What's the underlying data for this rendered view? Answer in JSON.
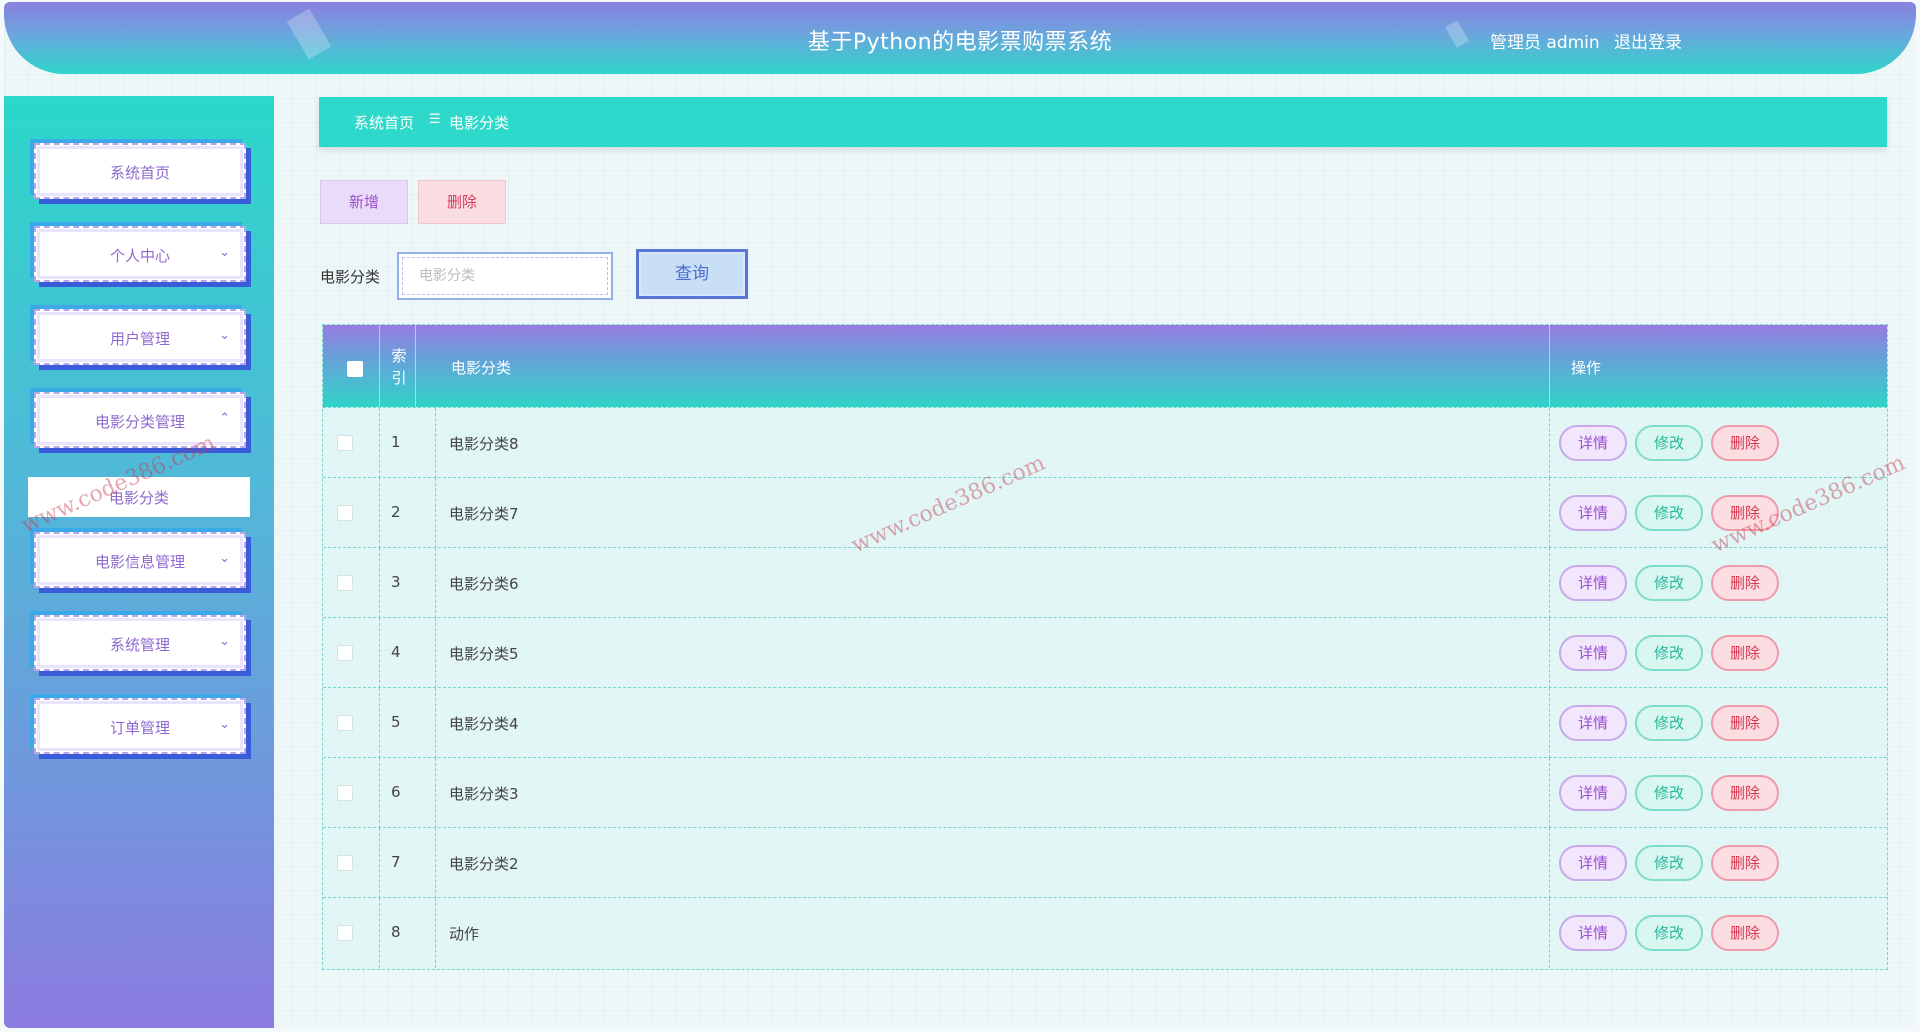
{
  "header": {
    "title": "基于Python的电影票购票系统",
    "user": "管理员 admin",
    "logout": "退出登录"
  },
  "sidebar": {
    "items": [
      {
        "label": "系统首页",
        "chevron": ""
      },
      {
        "label": "个人中心",
        "chevron": "⌄"
      },
      {
        "label": "用户管理",
        "chevron": "⌄"
      },
      {
        "label": "电影分类管理",
        "chevron": "⌃"
      },
      {
        "label": "电影信息管理",
        "chevron": "⌄"
      },
      {
        "label": "系统管理",
        "chevron": "⌄"
      },
      {
        "label": "订单管理",
        "chevron": "⌄"
      }
    ],
    "active_sub": "电影分类"
  },
  "breadcrumb": {
    "home": "系统首页",
    "separator": "☰",
    "current": "电影分类"
  },
  "actions": {
    "add": "新增",
    "delete": "删除"
  },
  "search": {
    "label": "电影分类",
    "placeholder": "电影分类",
    "button": "查询"
  },
  "table": {
    "headers": {
      "index": "索引",
      "category": "电影分类",
      "ops": "操作"
    },
    "rows": [
      {
        "index": "1",
        "category": "电影分类8"
      },
      {
        "index": "2",
        "category": "电影分类7"
      },
      {
        "index": "3",
        "category": "电影分类6"
      },
      {
        "index": "4",
        "category": "电影分类5"
      },
      {
        "index": "5",
        "category": "电影分类4"
      },
      {
        "index": "6",
        "category": "电影分类3"
      },
      {
        "index": "7",
        "category": "电影分类2"
      },
      {
        "index": "8",
        "category": "动作"
      }
    ],
    "row_actions": {
      "detail": "详情",
      "edit": "修改",
      "delete": "删除"
    }
  },
  "watermark": "www.code386.com",
  "colors": {
    "accent_teal": "#2ed8ca",
    "accent_purple": "#8b7fe0",
    "detail": "#9b4fd0",
    "edit": "#27b89a",
    "delete": "#d8384f"
  }
}
